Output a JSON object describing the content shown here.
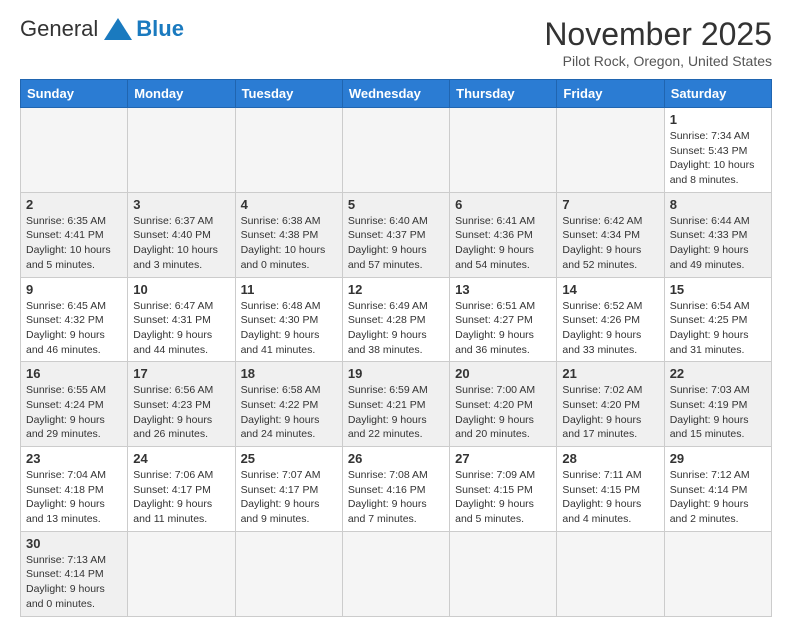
{
  "header": {
    "logo": {
      "general": "General",
      "blue": "Blue"
    },
    "title": "November 2025",
    "location": "Pilot Rock, Oregon, United States"
  },
  "calendar": {
    "days_of_week": [
      "Sunday",
      "Monday",
      "Tuesday",
      "Wednesday",
      "Thursday",
      "Friday",
      "Saturday"
    ],
    "weeks": [
      [
        {
          "day": "",
          "info": ""
        },
        {
          "day": "",
          "info": ""
        },
        {
          "day": "",
          "info": ""
        },
        {
          "day": "",
          "info": ""
        },
        {
          "day": "",
          "info": ""
        },
        {
          "day": "",
          "info": ""
        },
        {
          "day": "1",
          "info": "Sunrise: 7:34 AM\nSunset: 5:43 PM\nDaylight: 10 hours\nand 8 minutes."
        }
      ],
      [
        {
          "day": "2",
          "info": "Sunrise: 6:35 AM\nSunset: 4:41 PM\nDaylight: 10 hours\nand 5 minutes."
        },
        {
          "day": "3",
          "info": "Sunrise: 6:37 AM\nSunset: 4:40 PM\nDaylight: 10 hours\nand 3 minutes."
        },
        {
          "day": "4",
          "info": "Sunrise: 6:38 AM\nSunset: 4:38 PM\nDaylight: 10 hours\nand 0 minutes."
        },
        {
          "day": "5",
          "info": "Sunrise: 6:40 AM\nSunset: 4:37 PM\nDaylight: 9 hours\nand 57 minutes."
        },
        {
          "day": "6",
          "info": "Sunrise: 6:41 AM\nSunset: 4:36 PM\nDaylight: 9 hours\nand 54 minutes."
        },
        {
          "day": "7",
          "info": "Sunrise: 6:42 AM\nSunset: 4:34 PM\nDaylight: 9 hours\nand 52 minutes."
        },
        {
          "day": "8",
          "info": "Sunrise: 6:44 AM\nSunset: 4:33 PM\nDaylight: 9 hours\nand 49 minutes."
        }
      ],
      [
        {
          "day": "9",
          "info": "Sunrise: 6:45 AM\nSunset: 4:32 PM\nDaylight: 9 hours\nand 46 minutes."
        },
        {
          "day": "10",
          "info": "Sunrise: 6:47 AM\nSunset: 4:31 PM\nDaylight: 9 hours\nand 44 minutes."
        },
        {
          "day": "11",
          "info": "Sunrise: 6:48 AM\nSunset: 4:30 PM\nDaylight: 9 hours\nand 41 minutes."
        },
        {
          "day": "12",
          "info": "Sunrise: 6:49 AM\nSunset: 4:28 PM\nDaylight: 9 hours\nand 38 minutes."
        },
        {
          "day": "13",
          "info": "Sunrise: 6:51 AM\nSunset: 4:27 PM\nDaylight: 9 hours\nand 36 minutes."
        },
        {
          "day": "14",
          "info": "Sunrise: 6:52 AM\nSunset: 4:26 PM\nDaylight: 9 hours\nand 33 minutes."
        },
        {
          "day": "15",
          "info": "Sunrise: 6:54 AM\nSunset: 4:25 PM\nDaylight: 9 hours\nand 31 minutes."
        }
      ],
      [
        {
          "day": "16",
          "info": "Sunrise: 6:55 AM\nSunset: 4:24 PM\nDaylight: 9 hours\nand 29 minutes."
        },
        {
          "day": "17",
          "info": "Sunrise: 6:56 AM\nSunset: 4:23 PM\nDaylight: 9 hours\nand 26 minutes."
        },
        {
          "day": "18",
          "info": "Sunrise: 6:58 AM\nSunset: 4:22 PM\nDaylight: 9 hours\nand 24 minutes."
        },
        {
          "day": "19",
          "info": "Sunrise: 6:59 AM\nSunset: 4:21 PM\nDaylight: 9 hours\nand 22 minutes."
        },
        {
          "day": "20",
          "info": "Sunrise: 7:00 AM\nSunset: 4:20 PM\nDaylight: 9 hours\nand 20 minutes."
        },
        {
          "day": "21",
          "info": "Sunrise: 7:02 AM\nSunset: 4:20 PM\nDaylight: 9 hours\nand 17 minutes."
        },
        {
          "day": "22",
          "info": "Sunrise: 7:03 AM\nSunset: 4:19 PM\nDaylight: 9 hours\nand 15 minutes."
        }
      ],
      [
        {
          "day": "23",
          "info": "Sunrise: 7:04 AM\nSunset: 4:18 PM\nDaylight: 9 hours\nand 13 minutes."
        },
        {
          "day": "24",
          "info": "Sunrise: 7:06 AM\nSunset: 4:17 PM\nDaylight: 9 hours\nand 11 minutes."
        },
        {
          "day": "25",
          "info": "Sunrise: 7:07 AM\nSunset: 4:17 PM\nDaylight: 9 hours\nand 9 minutes."
        },
        {
          "day": "26",
          "info": "Sunrise: 7:08 AM\nSunset: 4:16 PM\nDaylight: 9 hours\nand 7 minutes."
        },
        {
          "day": "27",
          "info": "Sunrise: 7:09 AM\nSunset: 4:15 PM\nDaylight: 9 hours\nand 5 minutes."
        },
        {
          "day": "28",
          "info": "Sunrise: 7:11 AM\nSunset: 4:15 PM\nDaylight: 9 hours\nand 4 minutes."
        },
        {
          "day": "29",
          "info": "Sunrise: 7:12 AM\nSunset: 4:14 PM\nDaylight: 9 hours\nand 2 minutes."
        }
      ],
      [
        {
          "day": "30",
          "info": "Sunrise: 7:13 AM\nSunset: 4:14 PM\nDaylight: 9 hours\nand 0 minutes."
        },
        {
          "day": "",
          "info": ""
        },
        {
          "day": "",
          "info": ""
        },
        {
          "day": "",
          "info": ""
        },
        {
          "day": "",
          "info": ""
        },
        {
          "day": "",
          "info": ""
        },
        {
          "day": "",
          "info": ""
        }
      ]
    ]
  }
}
